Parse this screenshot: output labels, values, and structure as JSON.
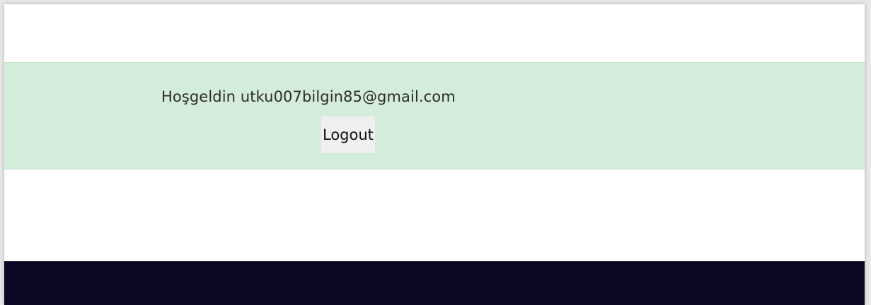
{
  "banner": {
    "welcome_message": "Hoşgeldin utku007bilgin85@gmail.com",
    "logout_label": "Logout",
    "background_color": "#d4ecda"
  },
  "footer": {
    "background_color": "#0c0722"
  }
}
